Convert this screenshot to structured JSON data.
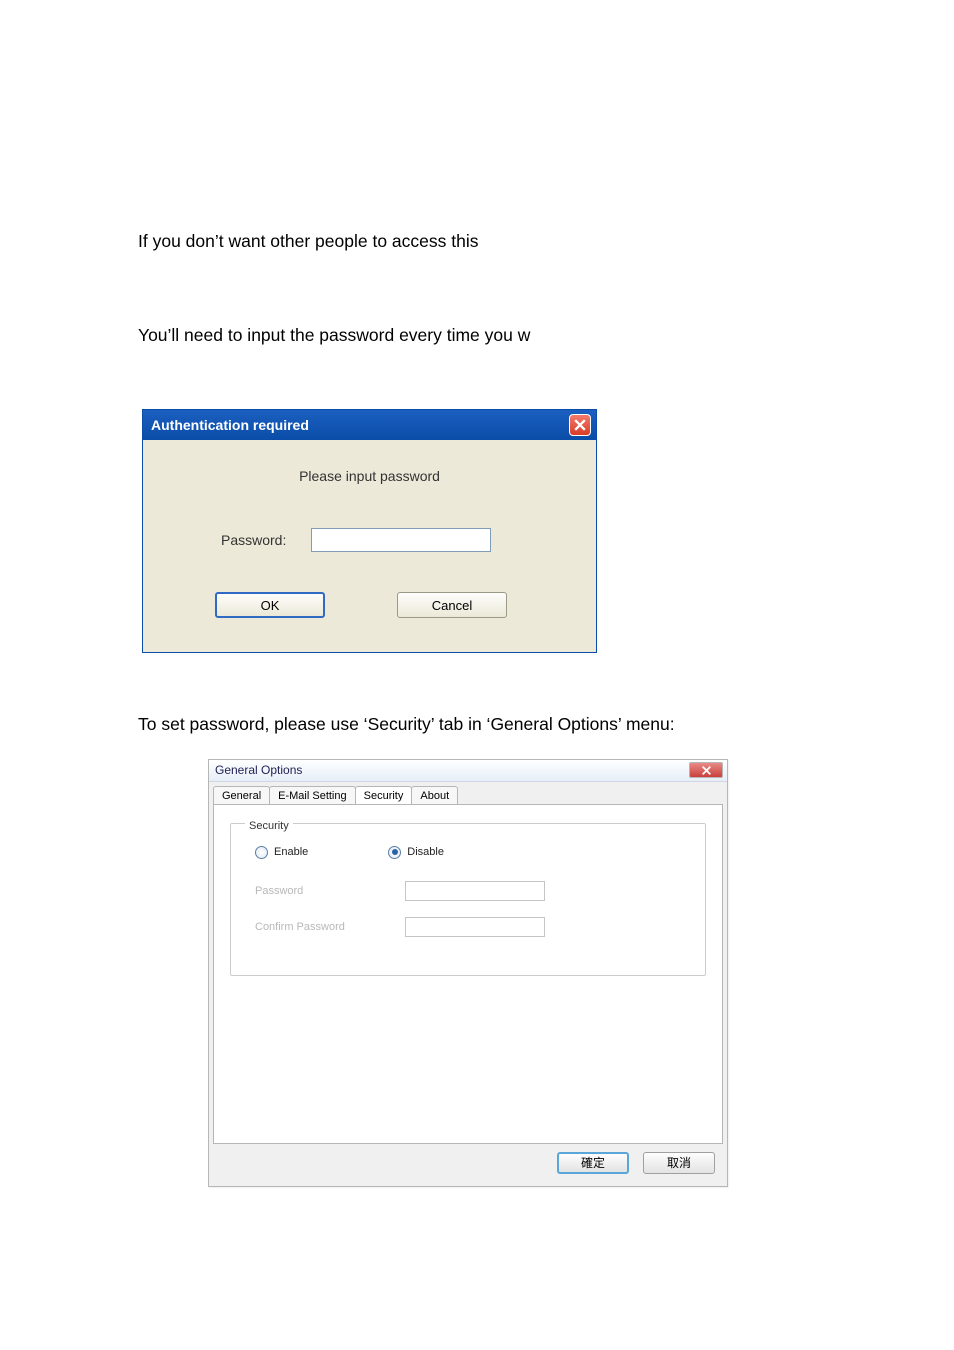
{
  "intro": {
    "line1": "If you don’t want other people to access this",
    "line2": "You’ll need to input the password every time you w",
    "line3": "To set password, please use ‘Security’ tab in ‘General Options’ menu:"
  },
  "auth_dialog": {
    "title": "Authentication required",
    "instruction": "Please input password",
    "password_label": "Password:",
    "password_value": "",
    "ok_label": "OK",
    "cancel_label": "Cancel"
  },
  "general_options": {
    "title": "General Options",
    "tabs": [
      {
        "label": "General",
        "active": false
      },
      {
        "label": "E-Mail Setting",
        "active": false
      },
      {
        "label": "Security",
        "active": true
      },
      {
        "label": "About",
        "active": false
      }
    ],
    "fieldset_label": "Security",
    "radios": {
      "enable_label": "Enable",
      "disable_label": "Disable",
      "selected": "disable"
    },
    "password_label": "Password",
    "password_value": "",
    "confirm_password_label": "Confirm Password",
    "confirm_password_value": "",
    "fields_disabled": true,
    "footer": {
      "ok_label": "確定",
      "cancel_label": "取消"
    }
  }
}
